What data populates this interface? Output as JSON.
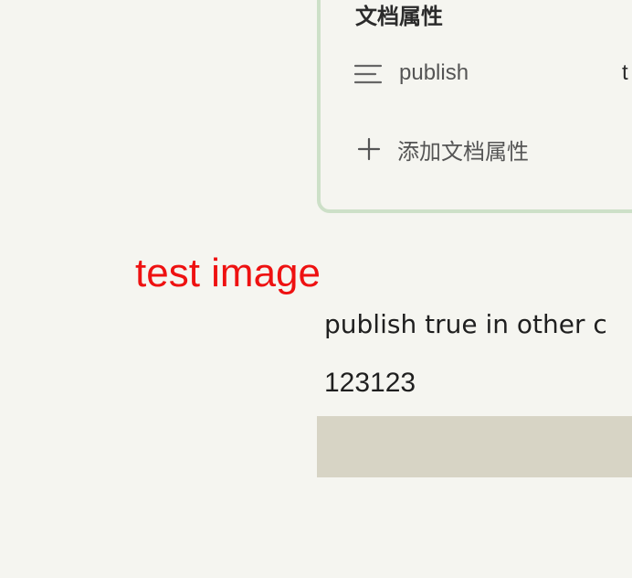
{
  "properties_panel": {
    "title": "文档属性",
    "rows": [
      {
        "icon": "text-lines-icon",
        "key": "publish",
        "value": "t"
      }
    ],
    "add_label": "添加文档属性"
  },
  "content": {
    "image_alt_text": "test image",
    "paragraph": "publish true in other c",
    "number_line": "123123"
  },
  "colors": {
    "panel_border": "#cde0c8",
    "background": "#f5f5f0",
    "alt_text_red": "#ee1111",
    "block_fill": "#d7d4c5"
  }
}
